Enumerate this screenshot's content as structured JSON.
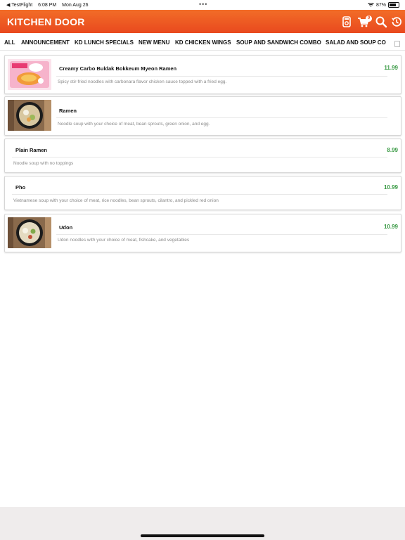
{
  "status_bar": {
    "back_app": "◀ TestFlight",
    "time": "6:08 PM",
    "date": "Mon Aug 26",
    "battery": "87%"
  },
  "header": {
    "title": "KITCHEN DOOR",
    "cart_count": "0",
    "icons": [
      "order-icon",
      "cart-icon",
      "search-icon",
      "history-icon"
    ],
    "color": "#ee5a23"
  },
  "tabs": [
    "ALL",
    "ANNOUNCEMENT",
    "KD LUNCH SPECIALS",
    "NEW MENU",
    "KD CHICKEN WINGS",
    "SOUP AND SANDWICH COMBO",
    "SALAD AND SOUP CO"
  ],
  "items": [
    {
      "name": "Creamy Carbo Buldak Bokkeum Myeon Ramen",
      "price": "11.99",
      "description": "Spicy stir-fried noodles with carbonara flavor chicken sauce topped with a fried egg.",
      "image": "ramen-package"
    },
    {
      "name": "Ramen",
      "price": "",
      "description": "Noodle soup with your choice of meat, bean sprouts, green onion, and egg.",
      "image": "ramen-bowl"
    },
    {
      "name": "Plain Ramen",
      "price": "8.99",
      "description": "Noodle soup with no toppings",
      "image": ""
    },
    {
      "name": "Pho",
      "price": "10.99",
      "description": "Vietnamese soup with your choice of meat, rice noodles, bean sprouts, cilantro, and pickled red onion",
      "image": ""
    },
    {
      "name": "Udon",
      "price": "10.99",
      "description": "Udon noodles with your choice of meat, fishcake, and vegetables",
      "image": "udon-bowl"
    }
  ],
  "colors": {
    "accent": "#ee5a23",
    "price": "#3a9a45"
  }
}
